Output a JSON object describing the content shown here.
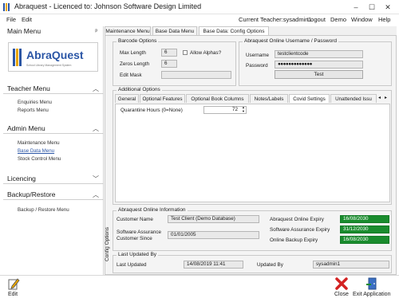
{
  "window": {
    "title": "Abraquest - Licenced to: Johnson Software Design Limited"
  },
  "menubar": {
    "file": "File",
    "edit": "Edit",
    "current_teacher": "Current Teacher:sysadmin1",
    "logout": "Logout",
    "demo": "Demo",
    "window": "Window",
    "help": "Help"
  },
  "sidebar": {
    "main_menu": "Main Menu",
    "pin": "ᵖ",
    "brand": "AbraQuest",
    "brand_tag": "School Library Management System",
    "teacher_menu": {
      "title": "Teacher Menu",
      "items": [
        "Enquiries Menu",
        "Reports Menu"
      ]
    },
    "admin_menu": {
      "title": "Admin Menu",
      "items": [
        "Maintenance Menu",
        "Base Data Menu",
        "Stock Control Menu"
      ]
    },
    "licencing": {
      "title": "Licencing"
    },
    "backup": {
      "title": "Backup/Restore",
      "items": [
        "Backup / Restore Menu"
      ]
    }
  },
  "tabs": [
    "Maintenance Menu",
    "Base Data Menu",
    "Base Data: Config Options"
  ],
  "barcode": {
    "title": "Barcode Options",
    "max_length_label": "Max Length",
    "max_length": "6",
    "zeros_length_label": "Zeros Length",
    "zeros_length": "6",
    "edit_mask_label": "Edit Mask",
    "edit_mask": "",
    "allow_alphas": "Allow Alphas?"
  },
  "online_login": {
    "title": "Abraquest Online Username / Password",
    "username_label": "Username",
    "username": "testclientcode",
    "password_label": "Password",
    "password": "●●●●●●●●●●●●●",
    "test_button": "Test"
  },
  "additional": {
    "title": "Additional Options",
    "subtabs": [
      "General",
      "Optional Features",
      "Optional Book Columns",
      "Notes/Labels",
      "Covid Settings",
      "Unattended Issu"
    ],
    "quarantine_label": "Quarantine Hours (0=None)",
    "quarantine_value": "72"
  },
  "online_info": {
    "title": "Abraquest Online Information",
    "customer_name_label": "Customer Name",
    "customer_name": "Test Client (Demo Database)",
    "sa_since_label_1": "Software Assurance",
    "sa_since_label_2": "Customer Since",
    "sa_since": "01/01/2005",
    "online_expiry_label": "Abraquest Online Expiry",
    "online_expiry": "16/08/2030",
    "sa_expiry_label": "Software Assurance Expiry",
    "sa_expiry": "31/12/2030",
    "backup_expiry_label": "Online Backup Expiry",
    "backup_expiry": "16/08/2030"
  },
  "last_updated": {
    "title": "Last Updated By",
    "last_updated_label": "Last Updated",
    "last_updated": "14/08/2019 11:41",
    "updated_by_label": "Updated By",
    "updated_by": "sysadmin1"
  },
  "side_caption": "Config Options",
  "footer": {
    "edit": "Edit",
    "close": "Close",
    "exit": "Exit Application"
  }
}
